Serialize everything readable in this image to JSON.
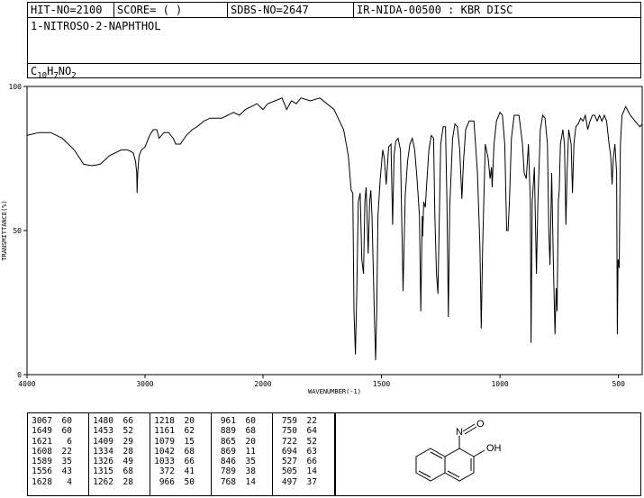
{
  "header": {
    "hit_no": "HIT-NO=2100",
    "score": "SCORE=  (  )",
    "sdbs_no": "SDBS-NO=2647",
    "ir_nida": "IR-NIDA-00500 : KBR DISC",
    "compound_name": "1-NITROSO-2-NAPHTHOL",
    "formula": {
      "c": "C",
      "c_n": "10",
      "h": "H",
      "h_n": "7",
      "rest": "NO",
      "o_n": "2"
    }
  },
  "chart_data": {
    "type": "line",
    "xlabel": "WAVENUMBER(-1)",
    "ylabel": "TRANSMITTANCE(%)",
    "xlim": [
      4000,
      400
    ],
    "ylim": [
      0,
      100
    ],
    "x_ticks": [
      4000,
      3000,
      2000,
      1500,
      1000,
      500
    ],
    "y_ticks": [
      0,
      50,
      100
    ],
    "x_tick_labels": [
      "4000",
      "3000",
      "2000",
      "1500",
      "1000",
      "500"
    ],
    "y_tick_labels": [
      "0",
      "50",
      "100"
    ],
    "series": [
      {
        "points": [
          [
            4000,
            83
          ],
          [
            3900,
            84
          ],
          [
            3800,
            84
          ],
          [
            3700,
            82
          ],
          [
            3600,
            78
          ],
          [
            3520,
            73
          ],
          [
            3450,
            72.5
          ],
          [
            3380,
            73
          ],
          [
            3300,
            76
          ],
          [
            3200,
            78
          ],
          [
            3150,
            78
          ],
          [
            3100,
            77
          ],
          [
            3080,
            74
          ],
          [
            3070,
            70
          ],
          [
            3067,
            63
          ],
          [
            3062,
            70
          ],
          [
            3050,
            76
          ],
          [
            3030,
            78
          ],
          [
            3000,
            79
          ],
          [
            2960,
            83
          ],
          [
            2930,
            85
          ],
          [
            2900,
            85
          ],
          [
            2880,
            82
          ],
          [
            2860,
            83
          ],
          [
            2840,
            84
          ],
          [
            2800,
            84
          ],
          [
            2760,
            82
          ],
          [
            2740,
            80
          ],
          [
            2700,
            80
          ],
          [
            2650,
            83
          ],
          [
            2600,
            85
          ],
          [
            2560,
            86
          ],
          [
            2500,
            88
          ],
          [
            2450,
            89
          ],
          [
            2400,
            89
          ],
          [
            2350,
            89
          ],
          [
            2300,
            90
          ],
          [
            2250,
            91
          ],
          [
            2200,
            90
          ],
          [
            2150,
            92
          ],
          [
            2100,
            93
          ],
          [
            2050,
            94
          ],
          [
            2000,
            92
          ],
          [
            1980,
            94
          ],
          [
            1950,
            95
          ],
          [
            1920,
            96
          ],
          [
            1900,
            92
          ],
          [
            1880,
            95
          ],
          [
            1860,
            94
          ],
          [
            1840,
            96
          ],
          [
            1800,
            95
          ],
          [
            1760,
            96
          ],
          [
            1700,
            92
          ],
          [
            1660,
            85
          ],
          [
            1640,
            76
          ],
          [
            1628,
            64
          ],
          [
            1621,
            63
          ],
          [
            1616,
            22
          ],
          [
            1610,
            7
          ],
          [
            1604,
            30
          ],
          [
            1598,
            60
          ],
          [
            1590,
            63
          ],
          [
            1583,
            40
          ],
          [
            1576,
            35
          ],
          [
            1570,
            60
          ],
          [
            1565,
            65
          ],
          [
            1556,
            42
          ],
          [
            1550,
            60
          ],
          [
            1545,
            64
          ],
          [
            1540,
            55
          ],
          [
            1530,
            20
          ],
          [
            1525,
            5
          ],
          [
            1520,
            22
          ],
          [
            1515,
            55
          ],
          [
            1505,
            68
          ],
          [
            1495,
            78
          ],
          [
            1488,
            75
          ],
          [
            1480,
            66
          ],
          [
            1470,
            79
          ],
          [
            1460,
            80
          ],
          [
            1453,
            52
          ],
          [
            1447,
            76
          ],
          [
            1440,
            81
          ],
          [
            1430,
            82
          ],
          [
            1420,
            78
          ],
          [
            1409,
            29
          ],
          [
            1400,
            62
          ],
          [
            1390,
            74
          ],
          [
            1380,
            80
          ],
          [
            1370,
            82
          ],
          [
            1360,
            78
          ],
          [
            1350,
            68
          ],
          [
            1340,
            55
          ],
          [
            1334,
            22
          ],
          [
            1328,
            55
          ],
          [
            1326,
            48
          ],
          [
            1322,
            60
          ],
          [
            1315,
            58
          ],
          [
            1308,
            68
          ],
          [
            1300,
            78
          ],
          [
            1290,
            83
          ],
          [
            1280,
            82
          ],
          [
            1275,
            55
          ],
          [
            1268,
            35
          ],
          [
            1262,
            28
          ],
          [
            1256,
            55
          ],
          [
            1250,
            80
          ],
          [
            1240,
            86
          ],
          [
            1230,
            86
          ],
          [
            1224,
            60
          ],
          [
            1218,
            20
          ],
          [
            1212,
            58
          ],
          [
            1200,
            82
          ],
          [
            1190,
            87
          ],
          [
            1180,
            86
          ],
          [
            1170,
            78
          ],
          [
            1161,
            61
          ],
          [
            1154,
            74
          ],
          [
            1145,
            85
          ],
          [
            1130,
            88
          ],
          [
            1110,
            88
          ],
          [
            1095,
            70
          ],
          [
            1085,
            45
          ],
          [
            1079,
            16
          ],
          [
            1073,
            45
          ],
          [
            1062,
            80
          ],
          [
            1050,
            75
          ],
          [
            1042,
            68
          ],
          [
            1036,
            72
          ],
          [
            1033,
            65
          ],
          [
            1025,
            80
          ],
          [
            1015,
            88
          ],
          [
            1000,
            91
          ],
          [
            990,
            90
          ],
          [
            980,
            80
          ],
          [
            972,
            50
          ],
          [
            966,
            50
          ],
          [
            960,
            60
          ],
          [
            952,
            82
          ],
          [
            940,
            90
          ],
          [
            920,
            90
          ],
          [
            905,
            80
          ],
          [
            898,
            70
          ],
          [
            889,
            68
          ],
          [
            880,
            80
          ],
          [
            872,
            60
          ],
          [
            869,
            11
          ],
          [
            864,
            60
          ],
          [
            855,
            72
          ],
          [
            846,
            35
          ],
          [
            840,
            60
          ],
          [
            830,
            85
          ],
          [
            820,
            90
          ],
          [
            810,
            89
          ],
          [
            800,
            80
          ],
          [
            794,
            50
          ],
          [
            789,
            38
          ],
          [
            782,
            70
          ],
          [
            775,
            40
          ],
          [
            768,
            14
          ],
          [
            763,
            30
          ],
          [
            759,
            22
          ],
          [
            754,
            60
          ],
          [
            750,
            64
          ],
          [
            745,
            80
          ],
          [
            735,
            85
          ],
          [
            728,
            80
          ],
          [
            722,
            52
          ],
          [
            717,
            70
          ],
          [
            710,
            85
          ],
          [
            700,
            80
          ],
          [
            694,
            63
          ],
          [
            688,
            80
          ],
          [
            680,
            86
          ],
          [
            670,
            87
          ],
          [
            660,
            89
          ],
          [
            650,
            88
          ],
          [
            640,
            90
          ],
          [
            630,
            85
          ],
          [
            620,
            88
          ],
          [
            610,
            90
          ],
          [
            600,
            90
          ],
          [
            590,
            88
          ],
          [
            580,
            90
          ],
          [
            570,
            88
          ],
          [
            560,
            90
          ],
          [
            550,
            88
          ],
          [
            540,
            80
          ],
          [
            533,
            76
          ],
          [
            527,
            66
          ],
          [
            522,
            75
          ],
          [
            515,
            80
          ],
          [
            508,
            70
          ],
          [
            505,
            14
          ],
          [
            502,
            40
          ],
          [
            497,
            37
          ],
          [
            492,
            80
          ],
          [
            485,
            90
          ],
          [
            470,
            93
          ],
          [
            450,
            90
          ],
          [
            430,
            88
          ],
          [
            410,
            86
          ],
          [
            400,
            87
          ]
        ]
      }
    ]
  },
  "peak_table": [
    [
      [
        "3067",
        "60"
      ],
      [
        "1649",
        "60"
      ],
      [
        "1621",
        "6"
      ],
      [
        "1608",
        "22"
      ],
      [
        "1589",
        "35"
      ],
      [
        "1556",
        "43"
      ],
      [
        "1628",
        "4"
      ]
    ],
    [
      [
        "1480",
        "66"
      ],
      [
        "1453",
        "52"
      ],
      [
        "1409",
        "29"
      ],
      [
        "1334",
        "28"
      ],
      [
        "1326",
        "49"
      ],
      [
        "1315",
        "68"
      ],
      [
        "1262",
        "28"
      ]
    ],
    [
      [
        "1218",
        "20"
      ],
      [
        "1161",
        "62"
      ],
      [
        "1079",
        "15"
      ],
      [
        "1042",
        "68"
      ],
      [
        "1033",
        "66"
      ],
      [
        "372",
        "41"
      ],
      [
        "966",
        "50"
      ]
    ],
    [
      [
        "961",
        "60"
      ],
      [
        "889",
        "68"
      ],
      [
        "865",
        "20"
      ],
      [
        "869",
        "11"
      ],
      [
        "846",
        "35"
      ],
      [
        "789",
        "38"
      ],
      [
        "768",
        "14"
      ]
    ],
    [
      [
        "759",
        "22"
      ],
      [
        "750",
        "64"
      ],
      [
        "722",
        "52"
      ],
      [
        "694",
        "63"
      ],
      [
        "527",
        "66"
      ],
      [
        "505",
        "14"
      ],
      [
        "497",
        "37"
      ]
    ]
  ],
  "structure": {
    "oh_label": "OH",
    "n_label": "N",
    "o_label": "O"
  }
}
